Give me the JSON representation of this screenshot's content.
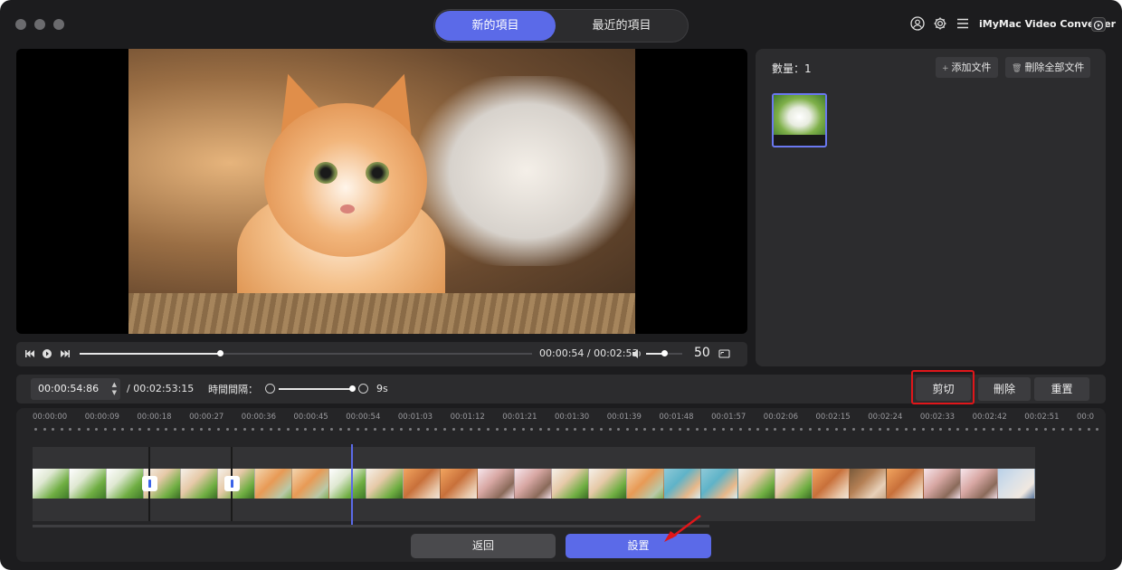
{
  "titlebar": {
    "tabs": [
      {
        "label": "新的項目",
        "active": true
      },
      {
        "label": "最近的項目",
        "active": false
      }
    ],
    "icons": [
      "user-icon",
      "gear-icon",
      "menu-icon"
    ],
    "app_name": "iMyMac Video Converter"
  },
  "player": {
    "time": "00:00:54 / 00:02:53",
    "progress": 0.31,
    "volume_value": "50",
    "volume_level": 0.5
  },
  "file_panel": {
    "count_label": "數量：1",
    "add_button": "添加文件",
    "delete_all_button": "刪除全部文件"
  },
  "trim_bar": {
    "time_value": "00:00:54:86",
    "total": "/ 00:02:53:15",
    "interval_label": "時間間隔：",
    "interval_value": "9s",
    "cut_button": "剪切",
    "delete_button": "刪除",
    "reset_button": "重置"
  },
  "timeline": {
    "ticks": [
      "00:00:00",
      "00:00:09",
      "00:00:18",
      "00:00:27",
      "00:00:36",
      "00:00:45",
      "00:00:54",
      "00:01:03",
      "00:01:12",
      "00:01:21",
      "00:01:30",
      "00:01:39",
      "00:01:48",
      "00:01:57",
      "00:02:06",
      "00:02:15",
      "00:02:24",
      "00:02:33",
      "00:02:42",
      "00:02:51",
      "00:0"
    ]
  },
  "footer": {
    "back_button": "返回",
    "settings_button": "設置"
  },
  "colors": {
    "accent": "#5b6ae8",
    "highlight": "#e0161a",
    "panel": "#2c2c2e"
  }
}
